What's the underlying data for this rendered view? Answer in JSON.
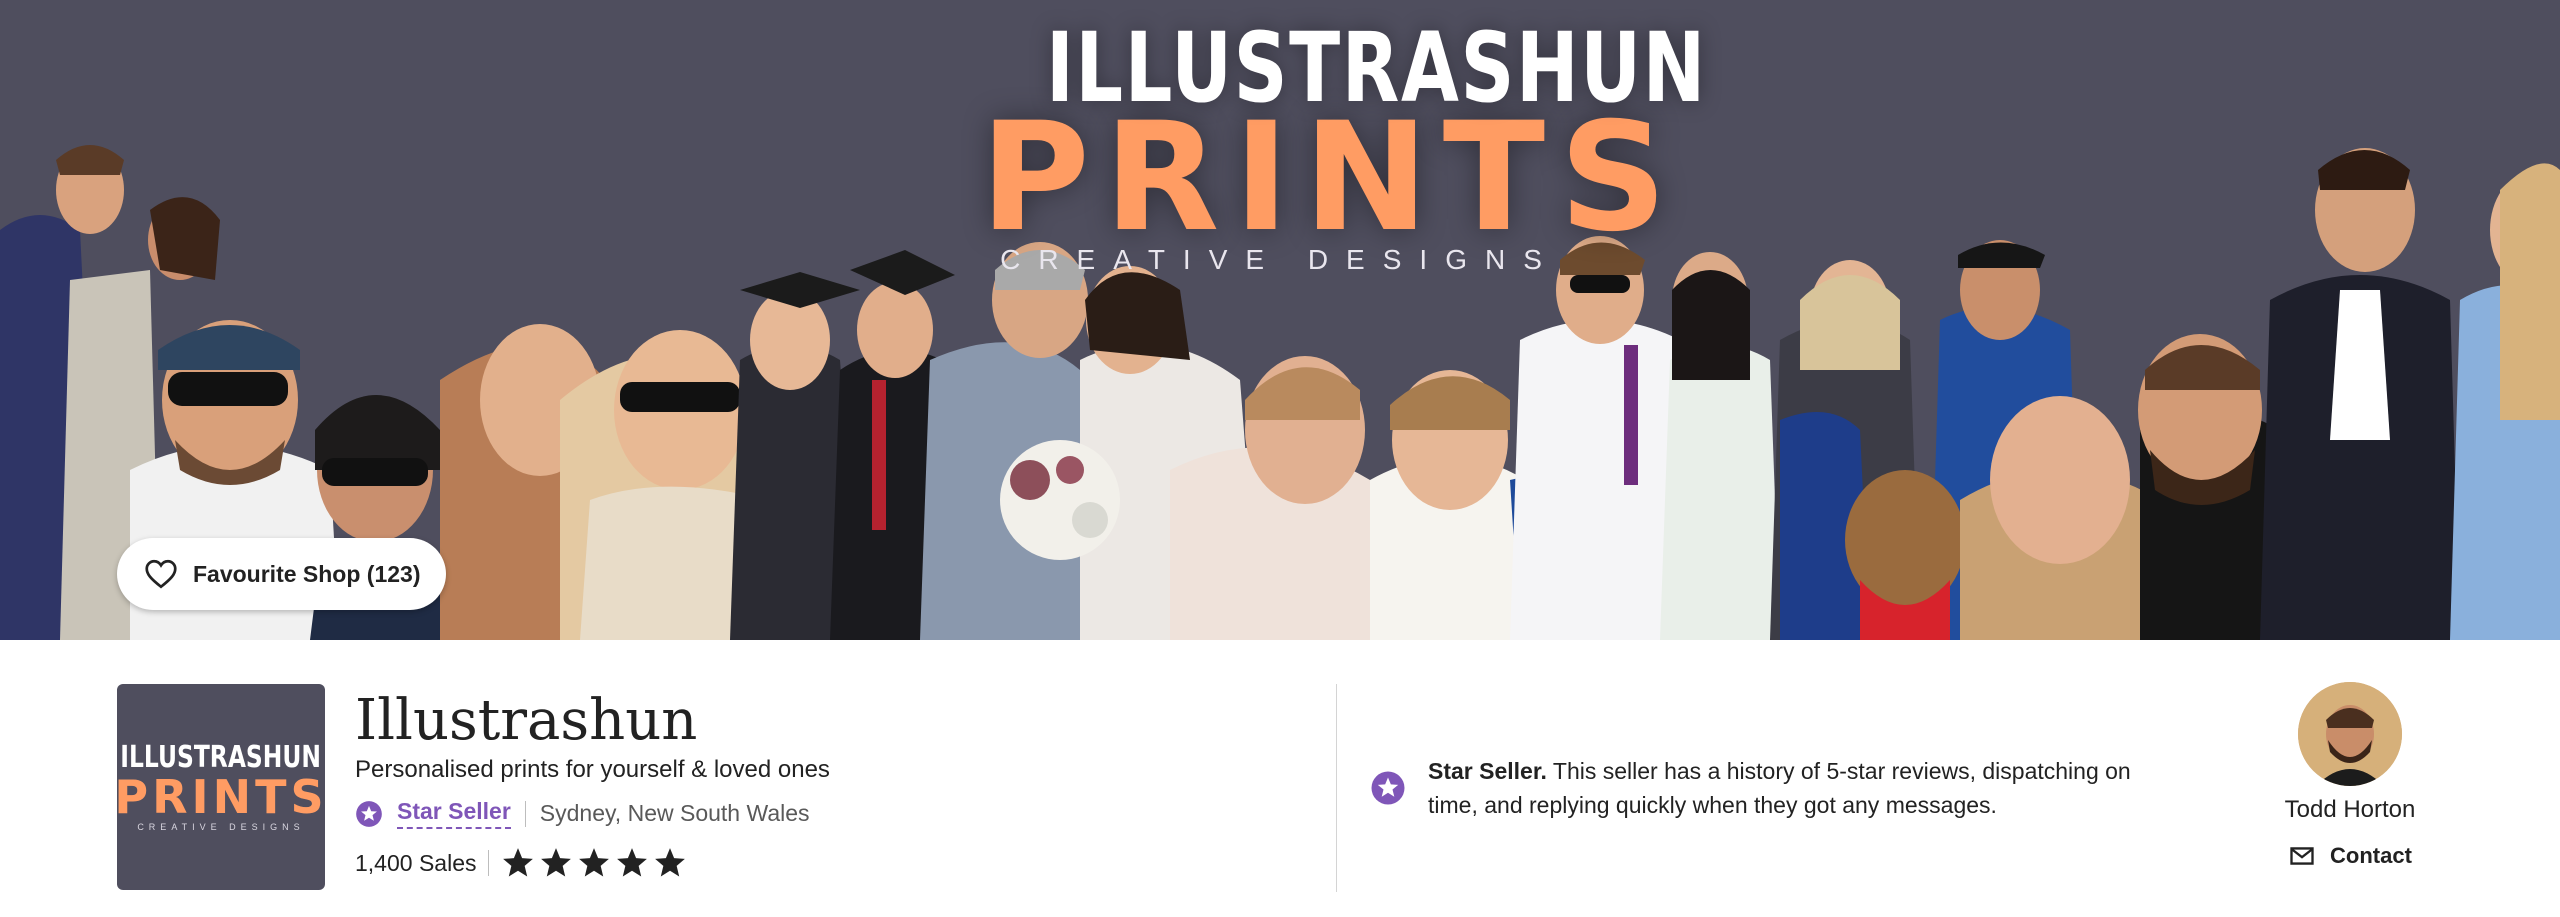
{
  "banner": {
    "logo_top": "ILLUSTRASHUN",
    "logo_main": "PRINTS",
    "logo_sub": "CREATIVE DESIGNS",
    "background_color": "#4f4e5e",
    "accent_color": "#ff9c63"
  },
  "favourite": {
    "label": "Favourite Shop (123)",
    "icon": "heart-outline-icon"
  },
  "shop": {
    "logo_top": "ILLUSTRASHUN",
    "logo_main": "PRINTS",
    "logo_sub": "CREATIVE DESIGNS",
    "name": "Illustrashun",
    "tagline": "Personalised prints for yourself & loved ones",
    "star_seller_label": "Star Seller",
    "location": "Sydney, New South Wales",
    "sales": "1,400 Sales",
    "rating_stars": 5,
    "star_color": "#7f56b8"
  },
  "star_info": {
    "title": "Star Seller.",
    "text": "This seller has a history of 5-star reviews, dispatching on time, and replying quickly when they got any messages."
  },
  "owner": {
    "name": "Todd Horton",
    "contact_label": "Contact",
    "contact_icon": "mail-icon"
  }
}
